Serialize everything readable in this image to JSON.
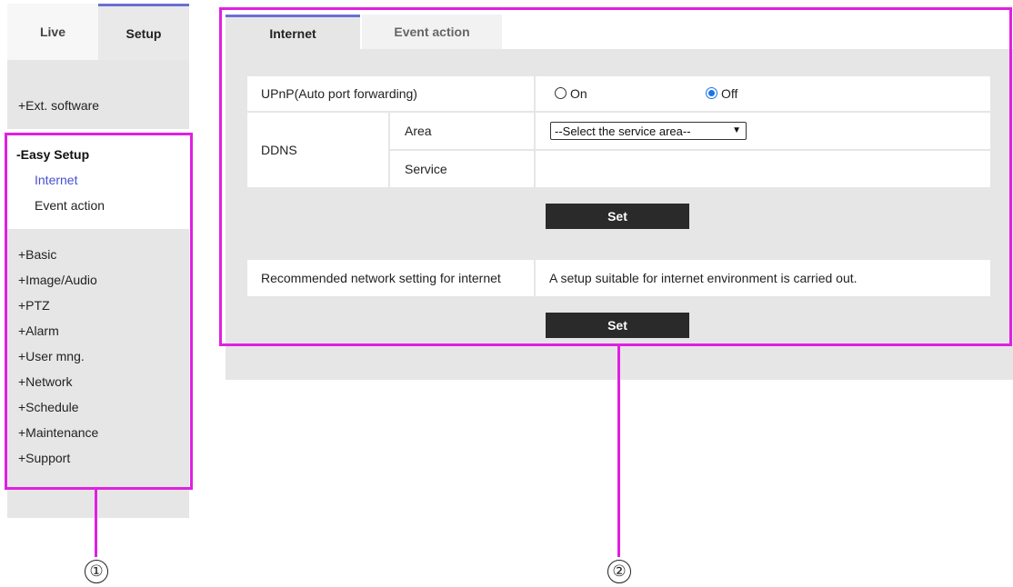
{
  "sidebar": {
    "tabs": [
      {
        "label": "Live"
      },
      {
        "label": "Setup"
      }
    ],
    "ext_software": "+Ext. software",
    "easy_setup": {
      "title": "-Easy Setup",
      "items": [
        {
          "label": "Internet"
        },
        {
          "label": "Event action"
        }
      ]
    },
    "menu": [
      {
        "label": "+Basic"
      },
      {
        "label": "+Image/Audio"
      },
      {
        "label": "+PTZ"
      },
      {
        "label": "+Alarm"
      },
      {
        "label": "+User mng."
      },
      {
        "label": "+Network"
      },
      {
        "label": "+Schedule"
      },
      {
        "label": "+Maintenance"
      },
      {
        "label": "+Support"
      }
    ]
  },
  "main": {
    "tabs": [
      {
        "label": "Internet"
      },
      {
        "label": "Event action"
      }
    ],
    "upnp": {
      "label": "UPnP(Auto port forwarding)",
      "on_label": "On",
      "off_label": "Off",
      "selected": "Off"
    },
    "ddns": {
      "label": "DDNS",
      "area_label": "Area",
      "area_value": "--Select the service area--",
      "service_label": "Service"
    },
    "set_label_1": "Set",
    "recommended": {
      "label": "Recommended network setting for internet",
      "description": "A setup suitable for internet environment is carried out."
    },
    "set_label_2": "Set"
  },
  "annotations": {
    "marker_1": "①",
    "marker_2": "②",
    "color": "#e020e0"
  },
  "colors": {
    "accent": "#6b6fd6",
    "link": "#4a4fd0",
    "button": "#2a2a2a",
    "panel_bg": "#e6e6e6"
  }
}
